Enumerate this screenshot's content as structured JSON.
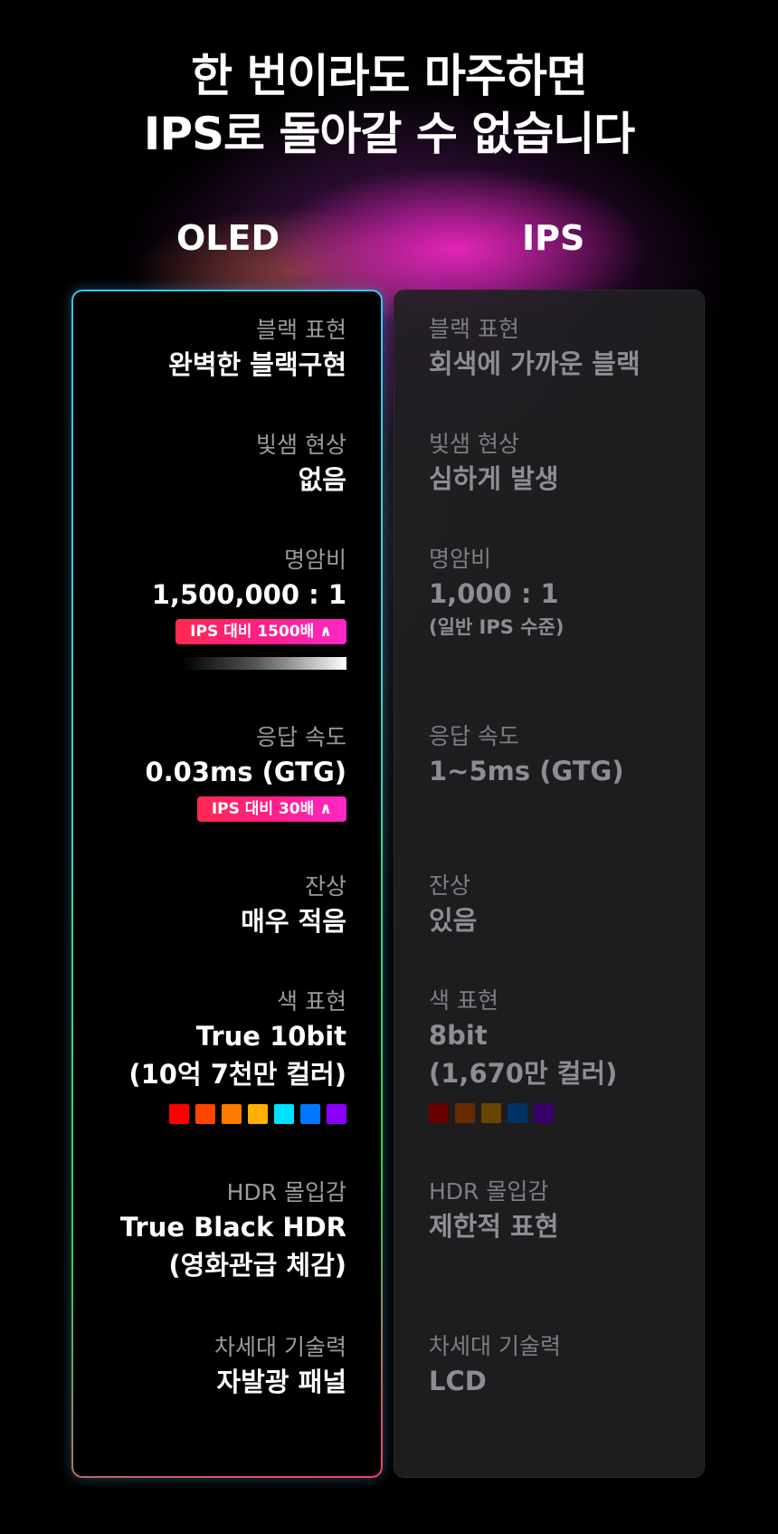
{
  "headline": {
    "line1": "한 번이라도 마주하면",
    "line2": "IPS로 돌아갈 수 없습니다"
  },
  "columns": {
    "oled": "OLED",
    "ips": "IPS"
  },
  "oled": {
    "black": {
      "label": "블랙 표현",
      "value": "완벽한 블랙구현"
    },
    "bleed": {
      "label": "빛샘 현상",
      "value": "없음"
    },
    "contrast": {
      "label": "명암비",
      "value": "1,500,000 : 1",
      "badge": "IPS 대비 1500배 ∧"
    },
    "response": {
      "label": "응답 속도",
      "value": "0.03ms (GTG)",
      "badge": "IPS 대비 30배 ∧"
    },
    "afterimage": {
      "label": "잔상",
      "value": "매우 적음"
    },
    "color": {
      "label": "색 표현",
      "value1": "True 10bit",
      "value2": "(10억 7천만 컬러)",
      "swatches": [
        "#ff0000",
        "#ff4500",
        "#ff7b00",
        "#ffb000",
        "#00e0ff",
        "#0077ff",
        "#8a00ff"
      ]
    },
    "hdr": {
      "label": "HDR 몰입감",
      "value1": "True Black HDR",
      "value2": "(영화관급 체감)"
    },
    "tech": {
      "label": "차세대 기술력",
      "value": "자발광 패널"
    }
  },
  "ips": {
    "black": {
      "label": "블랙 표현",
      "value": "회색에 가까운 블랙"
    },
    "bleed": {
      "label": "빛샘 현상",
      "value": "심하게 발생"
    },
    "contrast": {
      "label": "명암비",
      "value": "1,000 : 1",
      "note": "(일반 IPS 수준)"
    },
    "response": {
      "label": "응답 속도",
      "value": "1~5ms (GTG)"
    },
    "afterimage": {
      "label": "잔상",
      "value": "있음"
    },
    "color": {
      "label": "색 표현",
      "value1": "8bit",
      "value2": "(1,670만 컬러)",
      "swatches": [
        "#6a0000",
        "#6a2a00",
        "#6a4500",
        "#003266",
        "#3a006a"
      ]
    },
    "hdr": {
      "label": "HDR 몰입감",
      "value": "제한적 표현"
    },
    "tech": {
      "label": "차세대 기술력",
      "value": "LCD"
    }
  },
  "colors": {
    "badge_gradient_start": "#ff2a4f",
    "badge_gradient_end": "#ff27c8",
    "oled_border": "#2fc7ff"
  }
}
